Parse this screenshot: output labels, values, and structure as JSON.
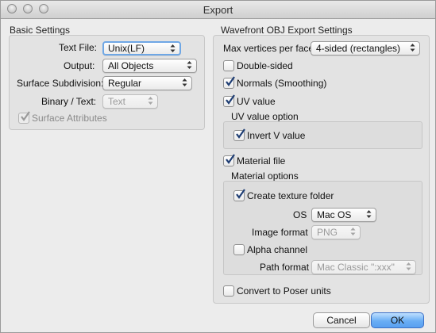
{
  "window": {
    "title": "Export"
  },
  "basic": {
    "title": "Basic Settings",
    "text_file_label": "Text File:",
    "text_file_value": "Unix(LF)",
    "output_label": "Output:",
    "output_value": "All Objects",
    "subdivision_label": "Surface Subdivision:",
    "subdivision_value": "Regular",
    "binary_label": "Binary / Text:",
    "binary_value": "Text",
    "surface_attr_label": "Surface Attributes"
  },
  "wavefront": {
    "title": "Wavefront OBJ Export Settings",
    "max_vertices_label": "Max vertices per face",
    "max_vertices_value": "4-sided (rectangles)",
    "double_sided_label": "Double-sided",
    "normals_label": "Normals (Smoothing)",
    "uv_label": "UV value",
    "uv_option_title": "UV value option",
    "invert_v_label": "Invert V value",
    "material_file_label": "Material file",
    "material_options_title": "Material options",
    "create_texture_label": "Create texture folder",
    "os_label": "OS",
    "os_value": "Mac OS",
    "image_format_label": "Image format",
    "image_format_value": "PNG",
    "alpha_label": "Alpha channel",
    "path_format_label": "Path format",
    "path_format_value": "Mac Classic \":xxx\"",
    "poser_label": "Convert to Poser units"
  },
  "buttons": {
    "cancel": "Cancel",
    "ok": "OK"
  },
  "checks": {
    "surface_attributes": true,
    "double_sided": false,
    "normals": true,
    "uv": true,
    "invert_v": true,
    "material_file": true,
    "create_texture": true,
    "alpha": false,
    "poser": false
  },
  "colors": {
    "accent": "#6aaef5",
    "check": "#1f3e74"
  }
}
